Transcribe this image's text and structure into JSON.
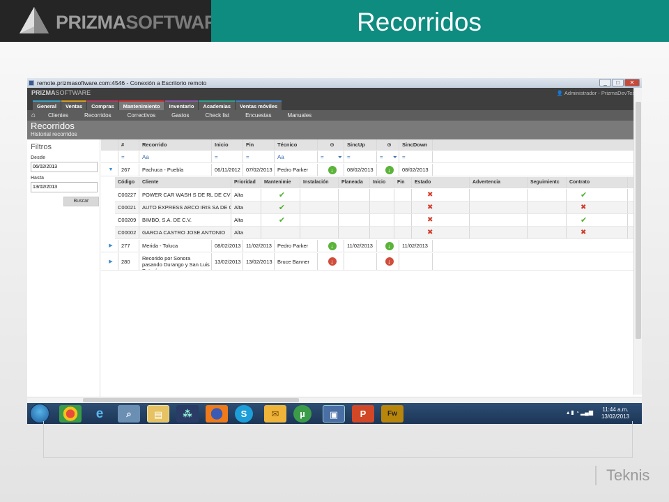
{
  "slide": {
    "logo_text_strong": "PRIZMA",
    "logo_text_light": "SOFTWARE",
    "title": "Recorridos",
    "footer_brand": "Teknis"
  },
  "window": {
    "title": "remote.prizmasoftware.com:4546 - Conexión a Escritorio remoto",
    "controls": [
      "_",
      "□",
      "✕"
    ]
  },
  "app": {
    "logo_strong": "PRIZMA",
    "logo_light": "SOFTWARE",
    "user": "Administrador - PrizmaDevTests",
    "menu": [
      "General",
      "Ventas",
      "Compras",
      "Mantenimiento",
      "Inventario",
      "Academias",
      "Ventas móviles"
    ],
    "submenu": [
      "Clientes",
      "Recorridos",
      "Correctivos",
      "Gastos",
      "Check list",
      "Encuestas",
      "Manuales"
    ],
    "page_title": "Recorridos",
    "page_subtitle": "Historial recorridos"
  },
  "filters": {
    "title": "Filtros",
    "desde_label": "Desde",
    "desde_value": "06/02/2013",
    "hasta_label": "Hasta",
    "hasta_value": "13/02/2013",
    "buscar_label": "Buscar"
  },
  "grid": {
    "columns": [
      "#",
      "Recorrido",
      "Inicio",
      "Fin",
      "Técnico",
      "",
      "SincUp",
      "",
      "SincDown"
    ],
    "filter_row": [
      "=",
      "Aa",
      "=",
      "=",
      "Aa",
      "=",
      "=",
      "=",
      "="
    ],
    "rows": [
      {
        "num": "267",
        "recorrido": "Pachuca - Puebla",
        "inicio": "06/11/2012",
        "fin": "07/02/2013",
        "tecnico": "Pedro Parker",
        "sincup": "08/02/2013",
        "sincdown": "08/02/2013"
      },
      {
        "num": "277",
        "recorrido": "Merida - Toluca",
        "inicio": "08/02/2013",
        "fin": "11/02/2013",
        "tecnico": "Pedro Parker",
        "sincup": "11/02/2013",
        "sincdown": "11/02/2013"
      },
      {
        "num": "280",
        "recorrido": "Recorido por Sonora pasando Durango y San Luis Potosí",
        "inicio": "13/02/2013",
        "fin": "13/02/2013",
        "tecnico": "Bruce Banner",
        "sincup": "",
        "sincdown": ""
      }
    ],
    "sub_columns": [
      "Código",
      "Cliente",
      "Prioridad",
      "Mantenimie",
      "Instalación",
      "Planeada",
      "Inicio",
      "Fin",
      "Estado",
      "Advertencia",
      "Seguimientc",
      "Contrato"
    ],
    "sub_rows": [
      {
        "codigo": "C00227",
        "cliente": "POWER CAR WASH S DE RL DE CV",
        "prioridad": "Alta",
        "mant": "✔",
        "estado": "✖",
        "contrato": "✔"
      },
      {
        "codigo": "C00021",
        "cliente": "AUTO EXPRESS ARCO IRIS SA DE CV",
        "prioridad": "Alta",
        "mant": "✔",
        "estado": "✖",
        "contrato": "✖"
      },
      {
        "codigo": "C00209",
        "cliente": "BIMBO, S.A. DE C.V.",
        "prioridad": "Alta",
        "mant": "✔",
        "estado": "✖",
        "contrato": "✔"
      },
      {
        "codigo": "C00002",
        "cliente": "GARCIA CASTRO JOSE ANTONIO",
        "prioridad": "Alta",
        "mant": "",
        "estado": "✖",
        "contrato": "✖"
      }
    ]
  },
  "taskbar": {
    "time": "11:44 a.m.",
    "date": "13/02/2013"
  },
  "colors": {
    "title_band": "#0e8c80",
    "logo_band": "#252525",
    "app_dark": "#3e3e3e",
    "ok": "#4caf2c",
    "error": "#d23b2b"
  }
}
